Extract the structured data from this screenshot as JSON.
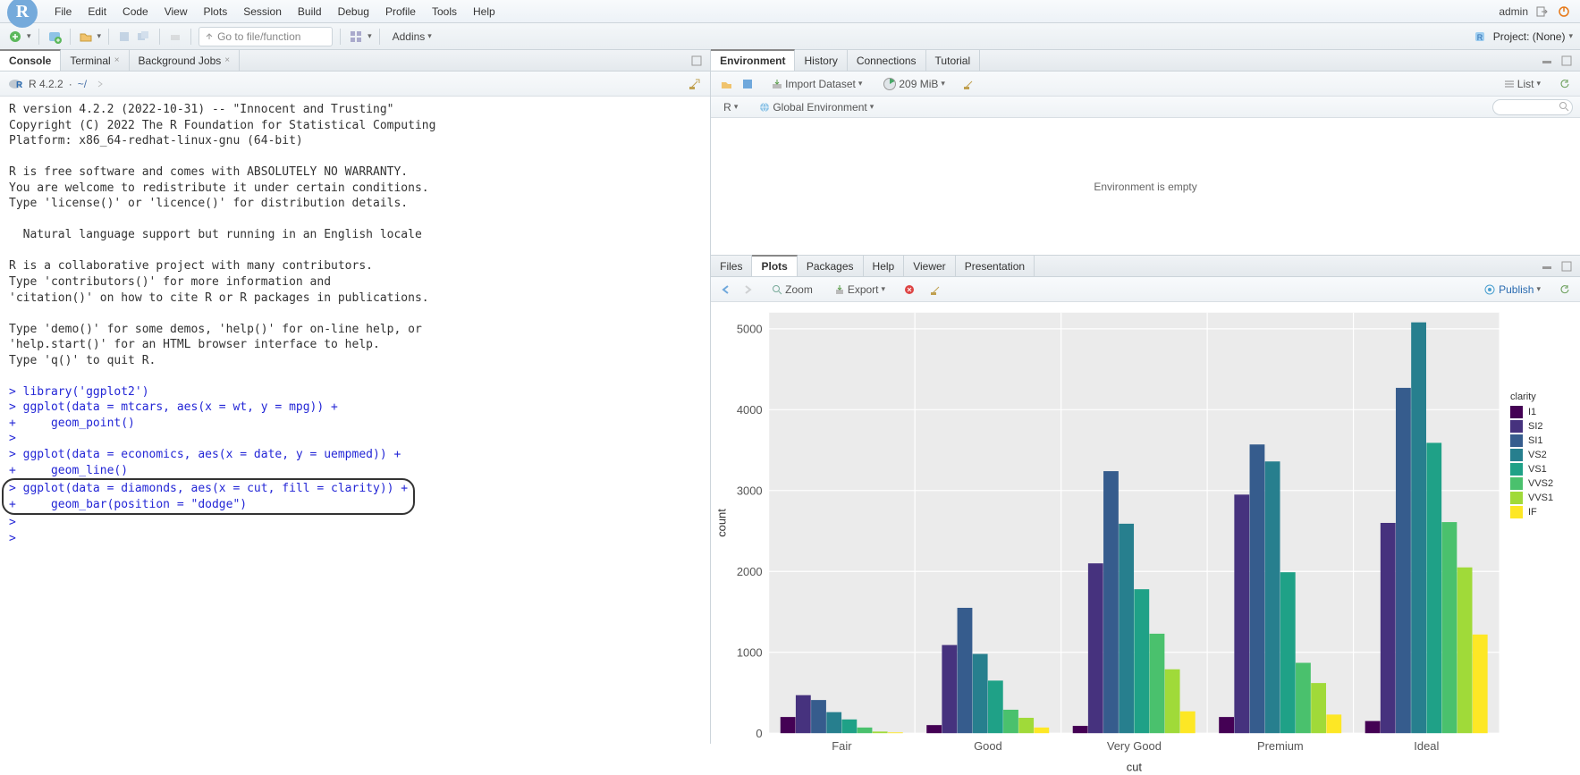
{
  "menubar": {
    "items": [
      "File",
      "Edit",
      "Code",
      "View",
      "Plots",
      "Session",
      "Build",
      "Debug",
      "Profile",
      "Tools",
      "Help"
    ],
    "user": "admin"
  },
  "toolbar": {
    "goto_placeholder": "Go to file/function",
    "addins": "Addins",
    "project_label": "Project: (None)"
  },
  "leftTabs": {
    "console": "Console",
    "terminal": "Terminal",
    "background": "Background Jobs"
  },
  "consoleHeader": {
    "version": "R 4.2.2",
    "path": "~/"
  },
  "consoleBanner": "R version 4.2.2 (2022-10-31) -- \"Innocent and Trusting\"\nCopyright (C) 2022 The R Foundation for Statistical Computing\nPlatform: x86_64-redhat-linux-gnu (64-bit)\n\nR is free software and comes with ABSOLUTELY NO WARRANTY.\nYou are welcome to redistribute it under certain conditions.\nType 'license()' or 'licence()' for distribution details.\n\n  Natural language support but running in an English locale\n\nR is a collaborative project with many contributors.\nType 'contributors()' for more information and\n'citation()' on how to cite R or R packages in publications.\n\nType 'demo()' for some demos, 'help()' for on-line help, or\n'help.start()' for an HTML browser interface to help.\nType 'q()' to quit R.\n",
  "consoleCode": {
    "l1": "> library('ggplot2')",
    "l2": "> ggplot(data = mtcars, aes(x = wt, y = mpg)) +",
    "l3": "+     geom_point()",
    "l4": "> ",
    "l5": "> ggplot(data = economics, aes(x = date, y = uempmed)) +",
    "l6": "+     geom_line()",
    "l7a": "> ",
    "l7": "ggplot(data = diamonds, aes(x = cut, fill = clarity)) +",
    "l8": "+     geom_bar(position = \"dodge\")",
    "l9": "> ",
    "l10": "> "
  },
  "envTabs": {
    "environment": "Environment",
    "history": "History",
    "connections": "Connections",
    "tutorial": "Tutorial"
  },
  "envToolbar": {
    "import": "Import Dataset",
    "mem": "209 MiB",
    "list": "List",
    "r": "R",
    "global": "Global Environment"
  },
  "envEmpty": "Environment is empty",
  "plotTabs": {
    "files": "Files",
    "plots": "Plots",
    "packages": "Packages",
    "help": "Help",
    "viewer": "Viewer",
    "presentation": "Presentation"
  },
  "plotToolbar": {
    "zoom": "Zoom",
    "export": "Export",
    "publish": "Publish"
  },
  "chart_data": {
    "type": "bar",
    "position": "dodge",
    "xlabel": "cut",
    "ylabel": "count",
    "ylim": [
      0,
      5200
    ],
    "yticks": [
      0,
      1000,
      2000,
      3000,
      4000,
      5000
    ],
    "categories": [
      "Fair",
      "Good",
      "Very Good",
      "Premium",
      "Ideal"
    ],
    "series": [
      {
        "name": "I1",
        "color": "#440154",
        "values": [
          200,
          100,
          90,
          200,
          150
        ]
      },
      {
        "name": "SI2",
        "color": "#46327e",
        "values": [
          470,
          1090,
          2100,
          2950,
          2600
        ]
      },
      {
        "name": "SI1",
        "color": "#365c8d",
        "values": [
          410,
          1550,
          3240,
          3570,
          4270
        ]
      },
      {
        "name": "VS2",
        "color": "#277f8e",
        "values": [
          260,
          980,
          2590,
          3360,
          5080
        ]
      },
      {
        "name": "VS1",
        "color": "#1fa187",
        "values": [
          170,
          650,
          1780,
          1990,
          3590
        ]
      },
      {
        "name": "VVS2",
        "color": "#4ac16d",
        "values": [
          70,
          290,
          1230,
          870,
          2610
        ]
      },
      {
        "name": "VVS1",
        "color": "#a0da39",
        "values": [
          20,
          190,
          790,
          620,
          2050
        ]
      },
      {
        "name": "IF",
        "color": "#fde725",
        "values": [
          10,
          70,
          270,
          230,
          1220
        ]
      }
    ],
    "legend_title": "clarity"
  }
}
